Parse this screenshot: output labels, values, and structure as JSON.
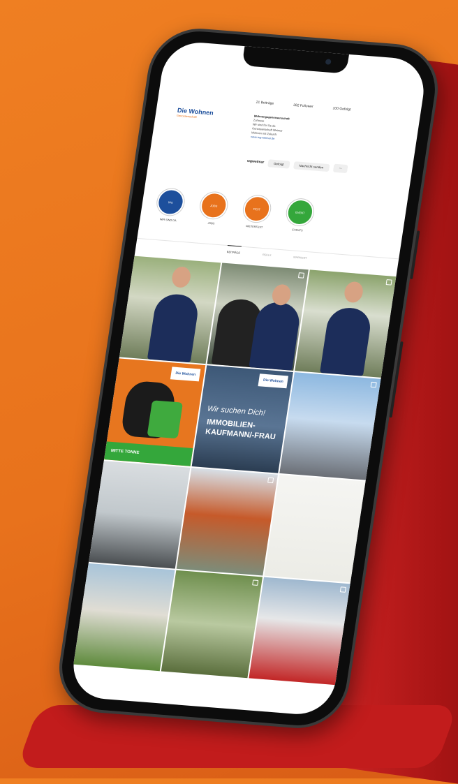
{
  "profile": {
    "logo_text": "Die Wohnen",
    "logo_sub": "Genossenschaft",
    "posts": "21 Beiträge",
    "followers": "282 Follower",
    "following": "100 Gefolgt",
    "bio_title": "Wohnungsgenossenschaft",
    "bio_lines": [
      "Zuhause",
      "Wir sind für Sie da",
      "Genossenschaft Weimar",
      "Wohnen mit Zukunft"
    ],
    "bio_link": "www.wg-weimar.de",
    "handle": "wgweimar",
    "follow_btn": "Gefolgt",
    "message_btn": "Nachricht senden"
  },
  "highlights": [
    {
      "label": "WIR SIND DA",
      "inner": "WG",
      "color": "#1d4f9c"
    },
    {
      "label": "JOBS",
      "inner": "JOBS",
      "color": "#e8721c"
    },
    {
      "label": "MIETERFEST",
      "inner": "FEST",
      "color": "#e8721c"
    },
    {
      "label": "EVENTS",
      "inner": "EVENT",
      "color": "#34a73b"
    }
  ],
  "tabs": [
    "BEITRÄGE",
    "REELS",
    "MARKIERT"
  ],
  "tiles": {
    "t4_band": "MITTE TONNE",
    "t4_badge": "Die Wohnen",
    "t5_badge": "Die Wohnen",
    "t5_script": "Wir suchen Dich!",
    "t5_big": "IMMOBILIEN-KAUFMANN/-FRAU"
  }
}
